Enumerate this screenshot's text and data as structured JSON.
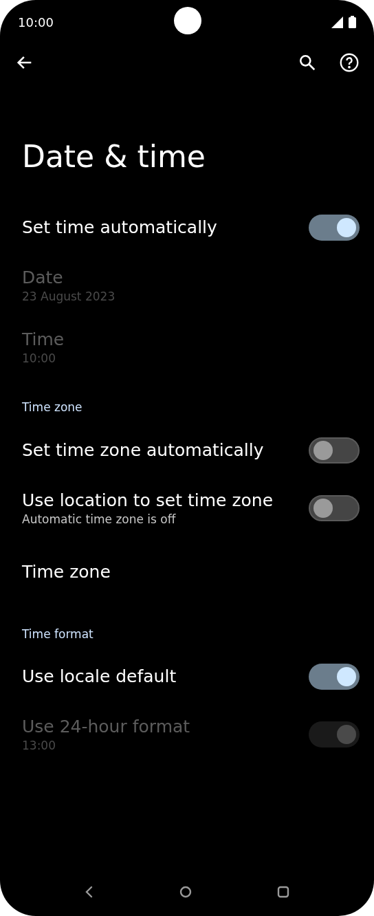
{
  "status_bar": {
    "time": "10:00"
  },
  "title": "Date & time",
  "items": [
    {
      "kind": "toggle",
      "title": "Set time automatically",
      "on": true,
      "disabled": false
    },
    {
      "kind": "text",
      "title": "Date",
      "subtitle": "23 August 2023",
      "disabled": true
    },
    {
      "kind": "text",
      "title": "Time",
      "subtitle": "10:00",
      "disabled": true
    },
    {
      "kind": "header",
      "title": "Time zone"
    },
    {
      "kind": "toggle",
      "title": "Set time zone automatically",
      "on": false,
      "disabled": false
    },
    {
      "kind": "toggle",
      "title": "Use location to set time zone",
      "subtitle": "Automatic time zone is off",
      "on": false,
      "disabled": false
    },
    {
      "kind": "text",
      "title": "Time zone",
      "disabled": false
    },
    {
      "kind": "header",
      "title": "Time format"
    },
    {
      "kind": "toggle",
      "title": "Use locale default",
      "on": true,
      "disabled": false
    },
    {
      "kind": "toggle",
      "title": "Use 24-hour format",
      "subtitle": "13:00",
      "on": true,
      "disabled": true
    }
  ]
}
